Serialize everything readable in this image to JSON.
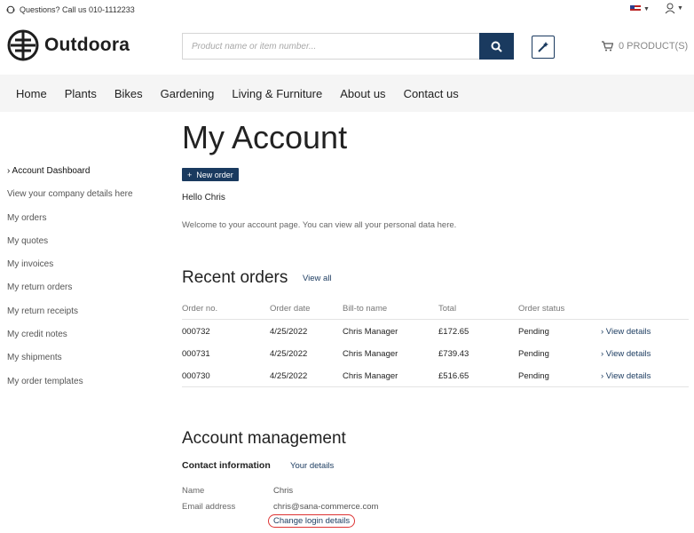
{
  "topbar": {
    "questions_text": "Questions? Call us 010-1112233"
  },
  "header": {
    "brand": "Outdoora",
    "search_placeholder": "Product name or item number...",
    "cart_label": "0 PRODUCT(S)"
  },
  "nav": {
    "items": [
      "Home",
      "Plants",
      "Bikes",
      "Gardening",
      "Living & Furniture",
      "About us",
      "Contact us"
    ]
  },
  "sidebar": {
    "items": [
      "› Account Dashboard",
      "View your company details here",
      "My orders",
      "My quotes",
      "My invoices",
      "My return orders",
      "My return receipts",
      "My credit notes",
      "My shipments",
      "My order templates"
    ]
  },
  "main": {
    "title": "My Account",
    "new_order_label": "New order",
    "hello": "Hello Chris",
    "welcome": "Welcome to your account page. You can view all your personal data here.",
    "recent_orders_title": "Recent orders",
    "view_all": "View all",
    "orders_table": {
      "headers": [
        "Order no.",
        "Order date",
        "Bill-to name",
        "Total",
        "Order status"
      ],
      "rows": [
        {
          "order_no": "000732",
          "date": "4/25/2022",
          "bill_to": "Chris Manager",
          "total": "£172.65",
          "status": "Pending",
          "action": "› View details"
        },
        {
          "order_no": "000731",
          "date": "4/25/2022",
          "bill_to": "Chris Manager",
          "total": "£739.43",
          "status": "Pending",
          "action": "› View details"
        },
        {
          "order_no": "000730",
          "date": "4/25/2022",
          "bill_to": "Chris Manager",
          "total": "£516.65",
          "status": "Pending",
          "action": "› View details"
        }
      ]
    },
    "account_management_title": "Account management",
    "contact_information_label": "Contact information",
    "your_details": "Your details",
    "name_label": "Name",
    "name_value": "Chris",
    "email_label": "Email address",
    "email_value": "chris@sana-commerce.com",
    "change_login": "Change login details"
  },
  "colors": {
    "accent": "#1a3a5f",
    "nav_bg": "#f5f5f5",
    "highlight_outline": "#dd3333"
  }
}
